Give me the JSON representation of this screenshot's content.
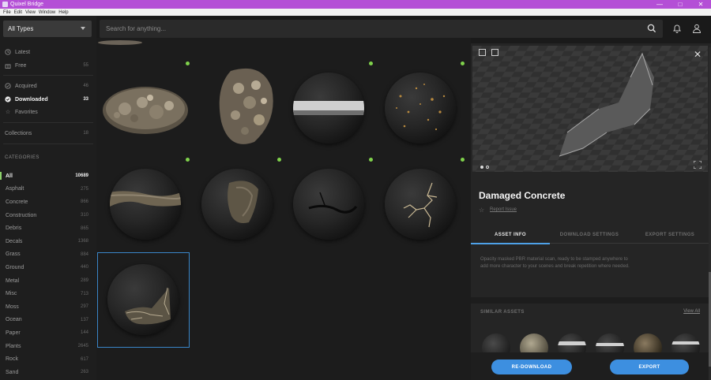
{
  "window": {
    "title": "Quixel Bridge",
    "controls": [
      "—",
      "□",
      "✕"
    ]
  },
  "menu": [
    "File",
    "Edit",
    "View",
    "Window",
    "Help"
  ],
  "sidebar": {
    "type_filter": "All Types",
    "nav": [
      {
        "label": "Latest",
        "count": "",
        "icon": "clock-icon"
      },
      {
        "label": "Free",
        "count": "55",
        "icon": "gift-icon"
      },
      {
        "label": "Acquired",
        "count": "46",
        "icon": "check-circle-icon"
      },
      {
        "label": "Downloaded",
        "count": "33",
        "icon": "check-filled-icon"
      },
      {
        "label": "Favorites",
        "count": "",
        "icon": "star-icon"
      },
      {
        "label": "Collections",
        "count": "18",
        "icon": ""
      }
    ],
    "categories_header": "CATEGORIES",
    "categories": [
      {
        "label": "All",
        "count": "10689"
      },
      {
        "label": "Asphalt",
        "count": "275"
      },
      {
        "label": "Concrete",
        "count": "866"
      },
      {
        "label": "Construction",
        "count": "310"
      },
      {
        "label": "Debris",
        "count": "865"
      },
      {
        "label": "Decals",
        "count": "1368"
      },
      {
        "label": "Grass",
        "count": "884"
      },
      {
        "label": "Ground",
        "count": "440"
      },
      {
        "label": "Metal",
        "count": "289"
      },
      {
        "label": "Misc",
        "count": "713"
      },
      {
        "label": "Moss",
        "count": "297"
      },
      {
        "label": "Ocean",
        "count": "137"
      },
      {
        "label": "Paper",
        "count": "144"
      },
      {
        "label": "Plants",
        "count": "2645"
      },
      {
        "label": "Rock",
        "count": "617"
      },
      {
        "label": "Sand",
        "count": "263"
      }
    ]
  },
  "search": {
    "placeholder": "Search for anything..."
  },
  "detail": {
    "title": "Damaged Concrete",
    "report": "Report Issue",
    "tabs": [
      "ASSET INFO",
      "DOWNLOAD SETTINGS",
      "EXPORT SETTINGS"
    ],
    "description": "Opacity masked PBR material scan, ready to be stamped anywhere to add more character to your scenes and break repetition where needed.",
    "similar_title": "SIMILAR ASSETS",
    "view_all": "View All",
    "redownload": "RE-DOWNLOAD",
    "export": "EXPORT"
  },
  "colors": {
    "accent": "#3d8fe0",
    "titlebar": "#b44fd6",
    "check": "#7fd14b"
  }
}
